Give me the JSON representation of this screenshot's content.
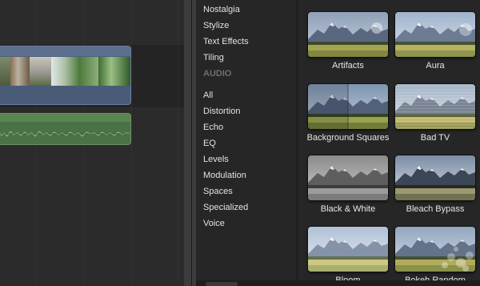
{
  "colors": {
    "timeline_bg": "#2b2b2b",
    "video_clip": "#4d5f7d",
    "audio_clip": "#4b7246",
    "panel_bg": "#262626",
    "text": "#e2e2e2",
    "heading_text": "#6f6f6f"
  },
  "categories": {
    "items": [
      {
        "label": "Nostalgia"
      },
      {
        "label": "Stylize"
      },
      {
        "label": "Text Effects"
      },
      {
        "label": "Tiling"
      },
      {
        "label": "AUDIO",
        "heading": true
      },
      {
        "label": "All"
      },
      {
        "label": "Distortion"
      },
      {
        "label": "Echo"
      },
      {
        "label": "EQ"
      },
      {
        "label": "Levels"
      },
      {
        "label": "Modulation"
      },
      {
        "label": "Spaces"
      },
      {
        "label": "Specialized"
      },
      {
        "label": "Voice"
      }
    ]
  },
  "effects": [
    {
      "label": "Artifacts",
      "style": "artifacts"
    },
    {
      "label": "Aura",
      "style": "aura"
    },
    {
      "label": "Background Squares",
      "style": "squares"
    },
    {
      "label": "Bad TV",
      "style": "badtv"
    },
    {
      "label": "Black & White",
      "style": "bw"
    },
    {
      "label": "Bleach Bypass",
      "style": "bleach"
    },
    {
      "label": "Bloom",
      "style": "bloom"
    },
    {
      "label": "Bokeh Random",
      "style": "bokeh"
    }
  ]
}
